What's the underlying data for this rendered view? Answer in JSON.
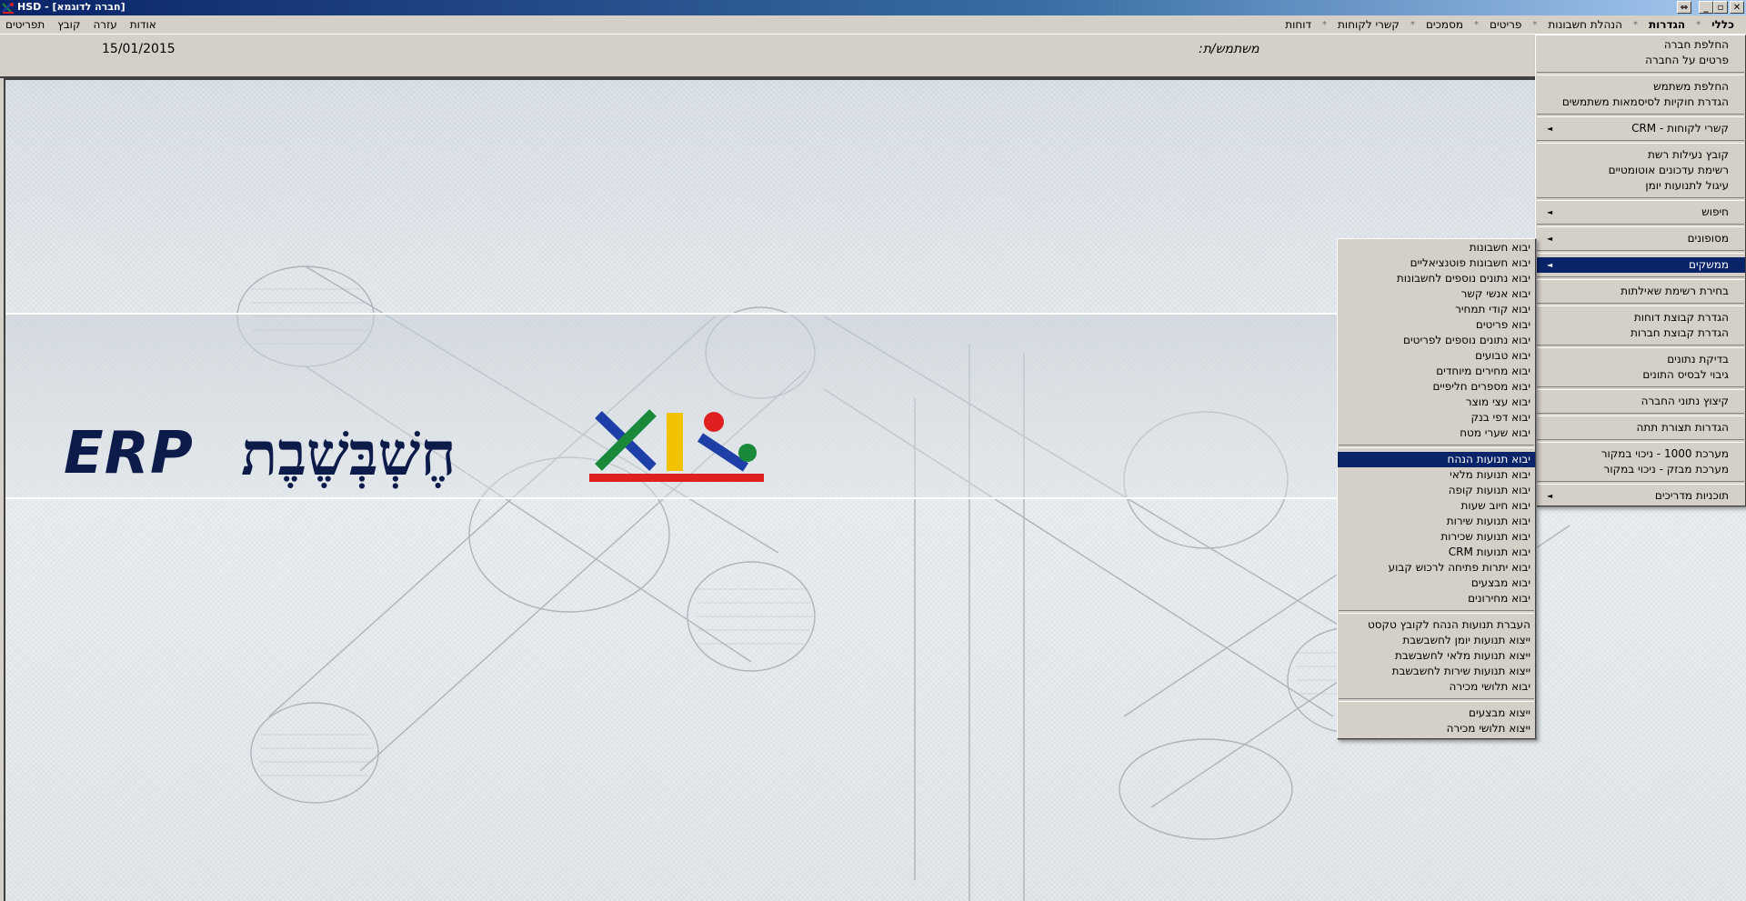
{
  "window": {
    "title": "HSD - [חברה לדוגמא]"
  },
  "menubar_right": [
    {
      "label": "כללי",
      "bold": true
    },
    {
      "label": "הגדרות",
      "bold": true
    },
    {
      "label": "הנהלת חשבונות",
      "bold": false
    },
    {
      "label": "פריטים",
      "bold": false
    },
    {
      "label": "מסמכים",
      "bold": false
    },
    {
      "label": "קשרי לקוחות",
      "bold": false
    },
    {
      "label": "דוחות",
      "bold": false
    }
  ],
  "menubar_left": [
    "אודות",
    "עזרה",
    "קובץ",
    "תפריטים"
  ],
  "infobar": {
    "date": "15/01/2015",
    "user_label": "משתמש/ת:"
  },
  "logo": {
    "erp": "ERP",
    "name": "חֶשְׁבְּשֶׁבֶת"
  },
  "settings_menu": [
    {
      "label": "החלפת חברה"
    },
    {
      "label": "פרטים על החברה"
    },
    {
      "divider": true
    },
    {
      "label": "החלפת משתמש"
    },
    {
      "label": "הגדרת חוקיות לסיסמאות משתמשים"
    },
    {
      "divider": true
    },
    {
      "label": "קשרי לקוחות - CRM",
      "submenu": true
    },
    {
      "divider": true
    },
    {
      "label": "קובץ נעילות רשת"
    },
    {
      "label": "רשימת עדכונים אוטומטיים"
    },
    {
      "label": "עיגול לתנועות יומן"
    },
    {
      "divider": true
    },
    {
      "label": "חיפוש",
      "submenu": true
    },
    {
      "divider": true
    },
    {
      "label": "מסופונים",
      "submenu": true
    },
    {
      "divider": true
    },
    {
      "label": "ממשקים",
      "submenu": true,
      "selected": true
    },
    {
      "divider": true
    },
    {
      "label": "בחירת רשימת שאילתות"
    },
    {
      "divider": true
    },
    {
      "label": "הגדרת קבוצת דוחות"
    },
    {
      "label": "הגדרת קבוצת חברות"
    },
    {
      "divider": true
    },
    {
      "label": "בדיקת נתונים"
    },
    {
      "label": "גיבוי לבסיס התונים"
    },
    {
      "divider": true
    },
    {
      "label": "קיצוץ נתוני החברה"
    },
    {
      "divider": true
    },
    {
      "label": "הגדרות תצורת תתה"
    },
    {
      "divider": true
    },
    {
      "label": "מערכת 1000 - ניכוי במקור"
    },
    {
      "label": "מערכת מבזק - ניכוי במקור"
    },
    {
      "divider": true
    },
    {
      "label": "תוכניות מדריכים",
      "submenu": true
    }
  ],
  "interfaces_menu": [
    {
      "label": "יבוא חשבונות"
    },
    {
      "label": "יבוא חשבונות פוטנציאליים"
    },
    {
      "label": "יבוא נתונים נוספים לחשבונות"
    },
    {
      "label": "יבוא אנשי קשר"
    },
    {
      "label": "יבוא קודי תמחיר"
    },
    {
      "label": "יבוא פריטים"
    },
    {
      "label": "יבוא נתונים נוספים לפריטים"
    },
    {
      "label": "יבוא טבועים"
    },
    {
      "label": "יבוא מחירים מיוחדים"
    },
    {
      "label": "יבוא מספרים חליפיים"
    },
    {
      "label": "יבוא עצי מוצר"
    },
    {
      "label": "יבוא דפי בנק"
    },
    {
      "label": "יבוא שערי מטח"
    },
    {
      "divider": true
    },
    {
      "label": "יבוא תנועות הנהח",
      "selected": true
    },
    {
      "label": "יבוא תנועות מלאי"
    },
    {
      "label": "יבוא תנועות קופה"
    },
    {
      "label": "יבוא חיוב שעות"
    },
    {
      "label": "יבוא תנועות שירות"
    },
    {
      "label": "יבוא תנועות שכירות"
    },
    {
      "label": "יבוא תנועות CRM"
    },
    {
      "label": "יבוא יתרות פתיחה לרכוש קבוע"
    },
    {
      "label": "יבוא מבצעים"
    },
    {
      "label": "יבוא מחירונים"
    },
    {
      "divider": true
    },
    {
      "label": "העברת תנועות הנהח לקובץ טקסט"
    },
    {
      "label": "ייצוא תנועות יומן לחשבשבת"
    },
    {
      "label": "ייצוא תנועות מלאי לחשבשבת"
    },
    {
      "label": "ייצוא תנועות שירות לחשבשבת"
    },
    {
      "label": "יבוא תלושי מכירה"
    },
    {
      "divider": true
    },
    {
      "label": "ייצוא מבצעים"
    },
    {
      "label": "ייצוא תלושי מכירה"
    }
  ],
  "colors": {
    "menu_bg": "#d4d0c8",
    "selection": "#0a246a",
    "logo_text": "#0d1b4a",
    "logo_green": "#1a8a3a",
    "logo_blue": "#1f3fa8",
    "logo_yellow": "#f2c200",
    "logo_red": "#e02020"
  }
}
